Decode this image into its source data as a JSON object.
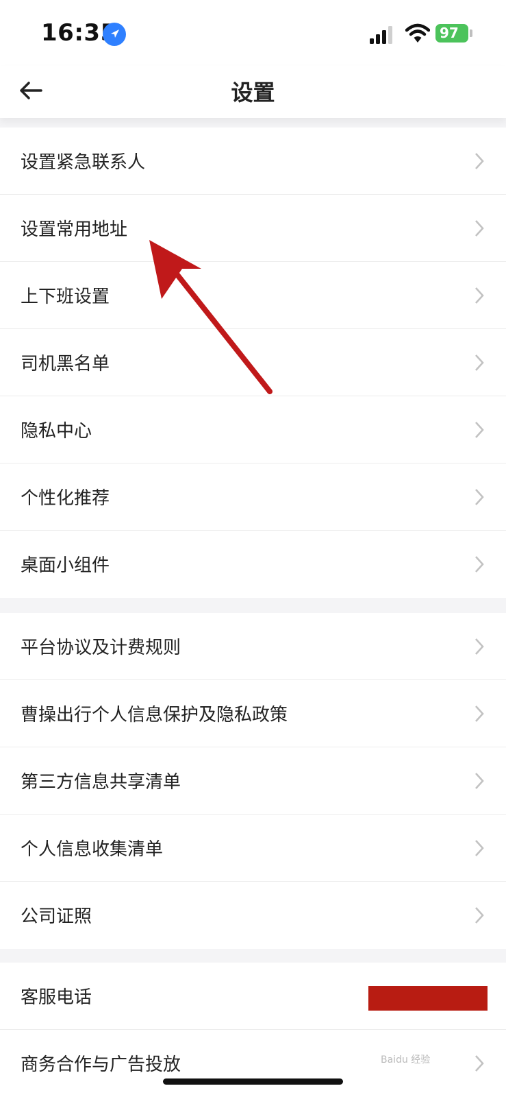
{
  "status_bar": {
    "time": "16:35",
    "battery": "97"
  },
  "nav": {
    "title": "设置"
  },
  "groups": [
    {
      "items": [
        {
          "label": "设置紧急联系人"
        },
        {
          "label": "设置常用地址"
        },
        {
          "label": "上下班设置"
        },
        {
          "label": "司机黑名单"
        },
        {
          "label": "隐私中心"
        },
        {
          "label": "个性化推荐"
        },
        {
          "label": "桌面小组件"
        }
      ]
    },
    {
      "items": [
        {
          "label": "平台协议及计费规则"
        },
        {
          "label": "曹操出行个人信息保护及隐私政策"
        },
        {
          "label": "第三方信息共享清单"
        },
        {
          "label": "个人信息收集清单"
        },
        {
          "label": "公司证照"
        }
      ]
    },
    {
      "items": [
        {
          "label": "客服电话"
        },
        {
          "label": "商务合作与广告投放"
        }
      ]
    }
  ],
  "colors": {
    "annotation_arrow": "#c0191a",
    "redaction": "#b81c12",
    "location_icon": "#2f80ff",
    "battery": "#4cc35b"
  },
  "watermark": "Baidu 经验 jingyan.baidu.com"
}
